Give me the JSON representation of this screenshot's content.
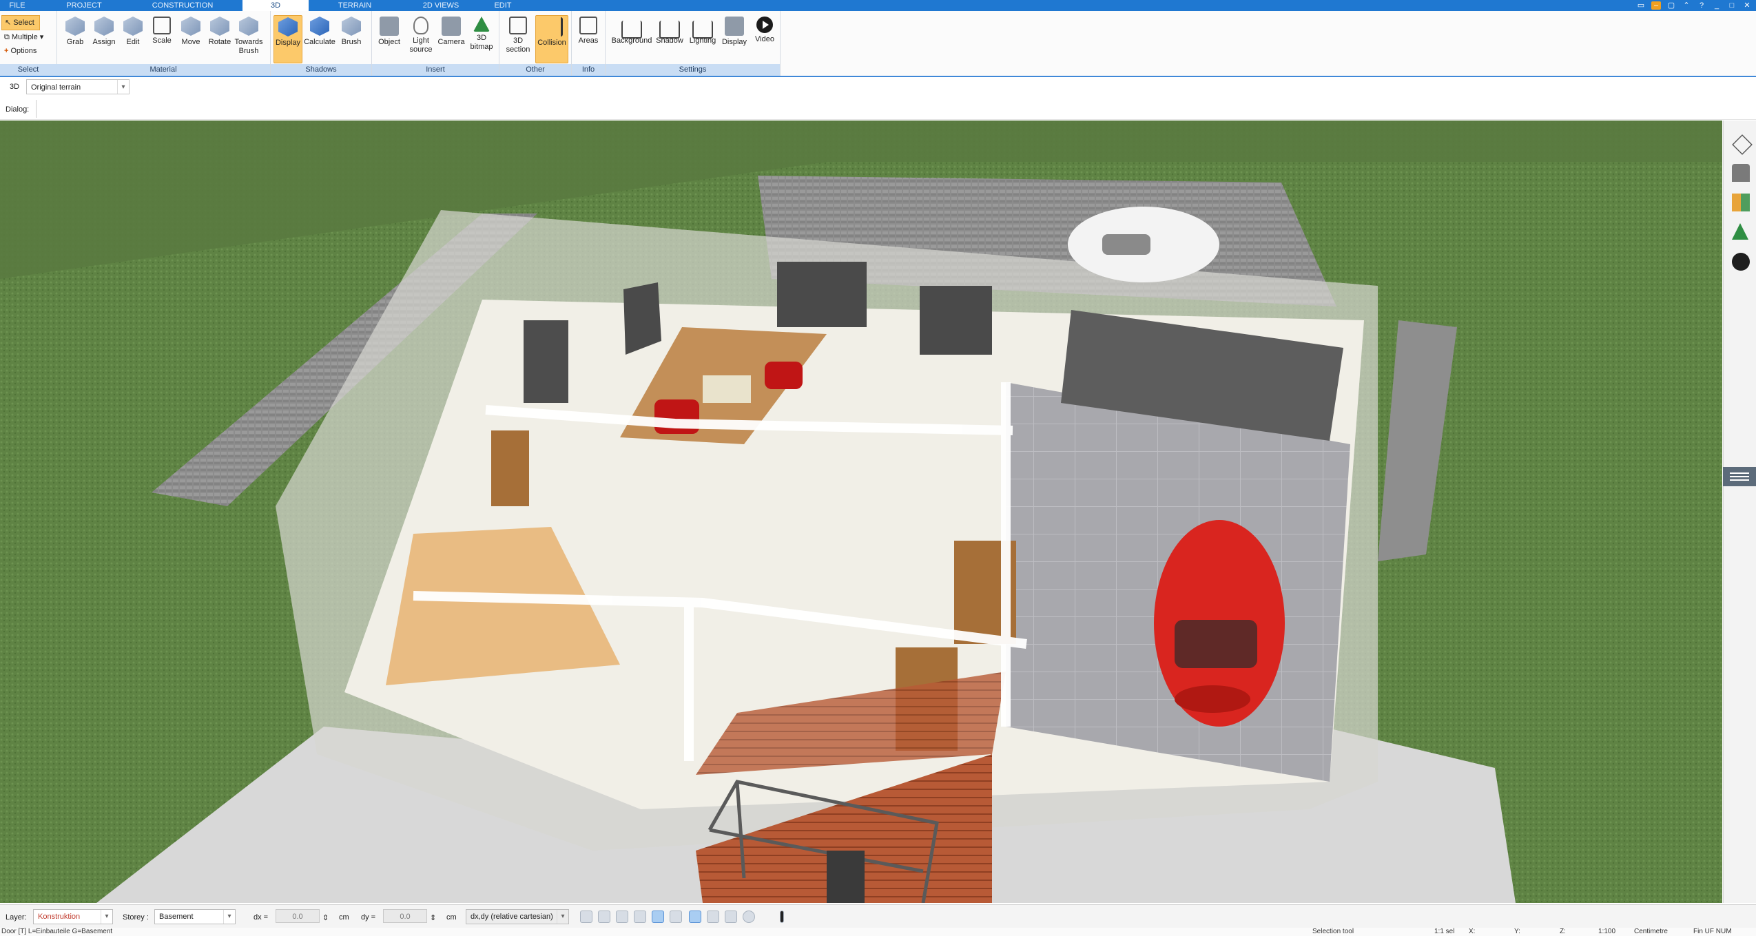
{
  "tabs": [
    "FILE",
    "PROJECT",
    "CONSTRUCTION",
    "3D",
    "TERRAIN",
    "2D VIEWS",
    "EDIT"
  ],
  "select_group": {
    "items": [
      "Select",
      "Multiple",
      "Options"
    ],
    "label": "Select"
  },
  "material_group": {
    "tools": [
      "Grab",
      "Assign",
      "Edit",
      "Scale",
      "Move",
      "Rotate",
      "Towards\nBrush"
    ],
    "label": "Material"
  },
  "shadows_group": {
    "tools": [
      "Display",
      "Calculate",
      "Brush"
    ],
    "label": "Shadows"
  },
  "insert_group": {
    "tools": [
      "Object",
      "Light\nsource",
      "Camera",
      "3D\nbitmap"
    ],
    "label": "Insert"
  },
  "other_group": {
    "tools": [
      "3D\nsection",
      "Collision"
    ],
    "label": "Other"
  },
  "info_group": {
    "tools": [
      "Areas"
    ],
    "label": "Info"
  },
  "settings_group": {
    "tools": [
      "Background",
      "Shadow",
      "Lighting",
      "Display",
      "Video"
    ],
    "label": "Settings"
  },
  "view3d": {
    "label": "3D",
    "terrain_option": "Original terrain"
  },
  "dialog_label": "Dialog:",
  "bottom": {
    "layer_label": "Layer:",
    "layer_value": "Konstruktion",
    "storey_label": "Storey :",
    "storey_value": "Basement",
    "dx_label": "dx =",
    "dx_value": "0.0",
    "dx_unit": "cm",
    "dy_label": "dy =",
    "dy_value": "0.0",
    "dy_unit": "cm",
    "mode_value": "dx,dy (relative cartesian)"
  },
  "status": {
    "object": "Door [T] L=Einbauteile G=Basement",
    "tool": "Selection tool",
    "selection": "1:1 sel",
    "x": "X:",
    "y": "Y:",
    "z": "Z:",
    "scale": "1:100",
    "unit": "Centimetre",
    "indicators": "Fin   UF  NUM"
  },
  "colors": {
    "tab_bar": "#1f78d1",
    "ribbon_group_label": "#c9ddf4",
    "active_tool": "#fcc96a",
    "grass": "#5d7f42"
  }
}
